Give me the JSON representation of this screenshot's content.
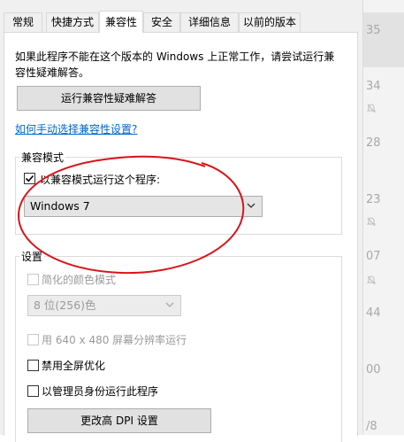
{
  "tabs": [
    {
      "label": "常规"
    },
    {
      "label": "快捷方式"
    },
    {
      "label": "兼容性"
    },
    {
      "label": "安全"
    },
    {
      "label": "详细信息"
    },
    {
      "label": "以前的版本"
    }
  ],
  "active_tab": "兼容性",
  "intro_text_1": "如果此程序不能在这个版本的 Windows 上正常工作，请尝试运行兼",
  "intro_text_2": "容性疑难解答。",
  "troubleshoot_button": "运行兼容性疑难解答",
  "manual_link": "如何手动选择兼容性设置?",
  "compat_mode": {
    "title": "兼容模式",
    "checkbox_label": "以兼容模式运行这个程序:",
    "checked": true,
    "os_selected": "Windows 7"
  },
  "settings": {
    "title": "设置",
    "reduced_color_label": "简化的颜色模式",
    "color_selected": "8 位(256)色",
    "res_640_label": "用 640 x 480 屏幕分辨率运行",
    "disable_fullscreen_label": "禁用全屏优化",
    "run_as_admin_label": "以管理员身份运行此程序",
    "dpi_button": "更改高 DPI 设置"
  },
  "background_numbers": [
    "35",
    "34",
    "28",
    "23",
    "07",
    "44",
    "00",
    "/8"
  ],
  "colors": {
    "annotation_red": "#d8141b",
    "link_blue": "#0066cc",
    "panel_bg": "#ffffff",
    "dialog_bg": "#f0f0f0"
  }
}
